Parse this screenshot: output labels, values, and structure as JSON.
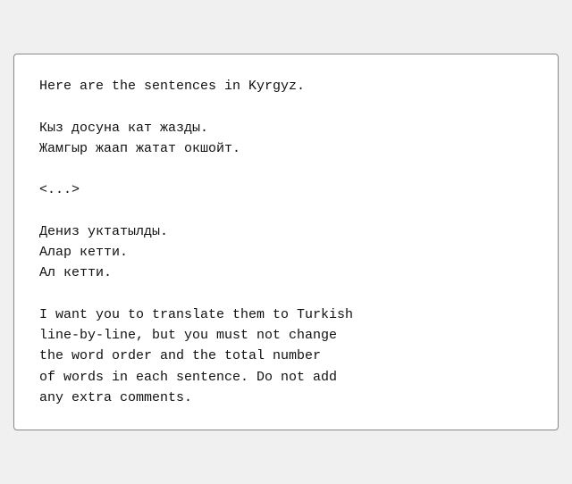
{
  "card": {
    "content": "Here are the sentences in Kyrgyz.\n\nКыз досуна кат жазды.\nЖамгыр жаап жатат окшойт.\n\n<...>\n\nДениз уктатылды.\nАлар кетти.\nАл кетти.\n\nI want you to translate them to Turkish\nline-by-line, but you must not change\nthe word order and the total number\nof words in each sentence. Do not add\nany extra comments."
  }
}
